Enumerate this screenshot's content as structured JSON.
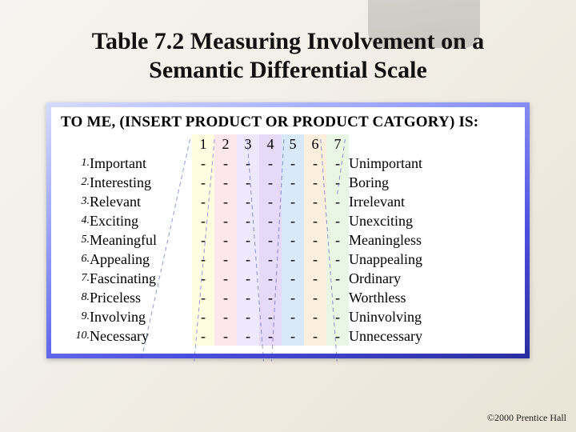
{
  "title": "Table 7.2  Measuring Involvement on a Semantic Differential Scale",
  "header": "TO ME, (INSERT PRODUCT OR PRODUCT CATGORY) IS:",
  "scale_numbers": [
    "1",
    "2",
    "3",
    "4",
    "5",
    "6",
    "7"
  ],
  "dash": "-",
  "items": [
    {
      "n": "1.",
      "left": "Important",
      "right": "Unimportant"
    },
    {
      "n": "2.",
      "left": "Interesting",
      "right": "Boring"
    },
    {
      "n": "3.",
      "left": "Relevant",
      "right": "Irrelevant"
    },
    {
      "n": "4.",
      "left": "Exciting",
      "right": "Unexciting"
    },
    {
      "n": "5.",
      "left": "Meaningful",
      "right": "Meaningless"
    },
    {
      "n": "6.",
      "left": "Appealing",
      "right": "Unappealing"
    },
    {
      "n": "7.",
      "left": "Fascinating",
      "right": "Ordinary"
    },
    {
      "n": "8.",
      "left": "Priceless",
      "right": "Worthless"
    },
    {
      "n": "9.",
      "left": "Involving",
      "right": "Uninvolving"
    },
    {
      "n": "10.",
      "left": "Necessary",
      "right": "Unnecessary"
    }
  ],
  "copyright": "©2000 Prentice Hall",
  "chart_data": {
    "type": "table",
    "title": "Table 7.2 Measuring Involvement on a Semantic Differential Scale",
    "scale_range": [
      1,
      7
    ],
    "rows": [
      {
        "left_anchor": "Important",
        "right_anchor": "Unimportant"
      },
      {
        "left_anchor": "Interesting",
        "right_anchor": "Boring"
      },
      {
        "left_anchor": "Relevant",
        "right_anchor": "Irrelevant"
      },
      {
        "left_anchor": "Exciting",
        "right_anchor": "Unexciting"
      },
      {
        "left_anchor": "Meaningful",
        "right_anchor": "Meaningless"
      },
      {
        "left_anchor": "Appealing",
        "right_anchor": "Unappealing"
      },
      {
        "left_anchor": "Fascinating",
        "right_anchor": "Ordinary"
      },
      {
        "left_anchor": "Priceless",
        "right_anchor": "Worthless"
      },
      {
        "left_anchor": "Involving",
        "right_anchor": "Uninvolving"
      },
      {
        "left_anchor": "Necessary",
        "right_anchor": "Unnecessary"
      }
    ]
  }
}
